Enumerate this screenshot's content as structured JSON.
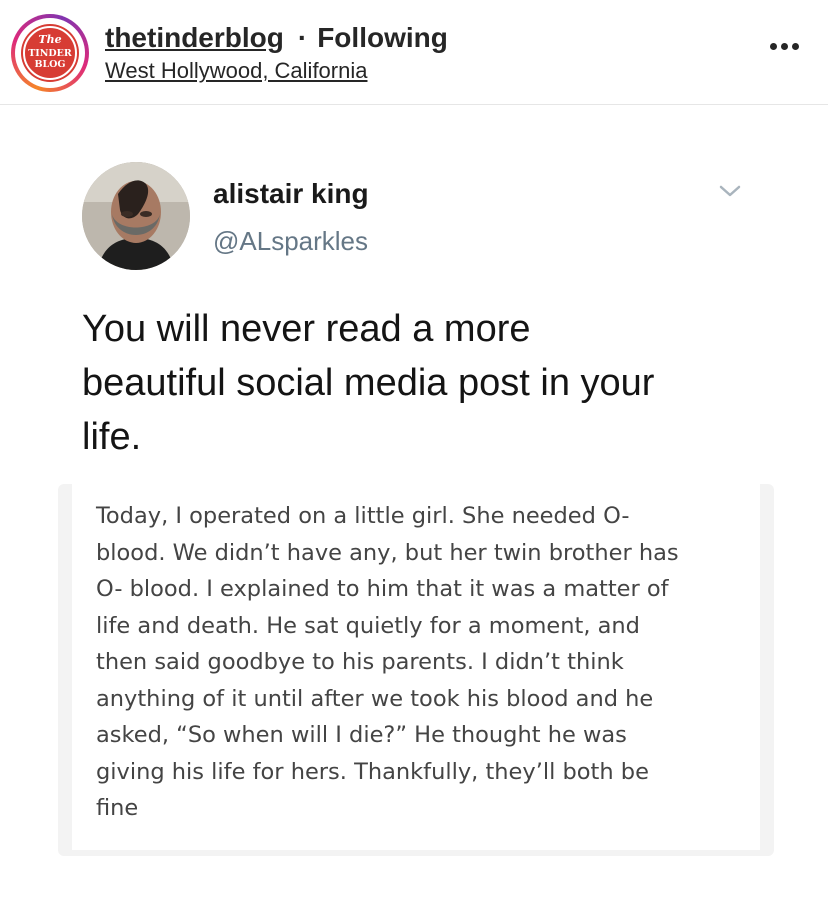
{
  "header": {
    "username": "thetinderblog",
    "separator": "·",
    "follow_status": "Following",
    "location": "West Hollywood, California",
    "avatar_logo_text": [
      "The",
      "TINDER",
      "BLOG"
    ]
  },
  "tweet": {
    "name": "alistair king",
    "handle": "@ALsparkles",
    "lines": [
      "You will never read a more",
      "beautiful social media post in your",
      "life."
    ]
  },
  "quoted_post": {
    "lines": [
      "Today, I operated on a little girl. She needed O-",
      "blood. We didn’t have any, but her twin brother has",
      "O- blood. I explained to him that it was a matter of",
      "life and death. He sat quietly for a moment, and",
      "then said goodbye to his parents. I didn’t think",
      "anything of it until after we took his blood and he",
      "asked, “So when will I die?” He thought he was",
      "giving his life for hers. Thankfully, they’ll both be",
      "fine"
    ]
  },
  "colors": {
    "brand_red": "#d73c34",
    "handle_gray": "#657786",
    "text_dark": "#262626"
  },
  "icons": {
    "more": "more-options-icon",
    "chevron": "chevron-down-icon"
  }
}
